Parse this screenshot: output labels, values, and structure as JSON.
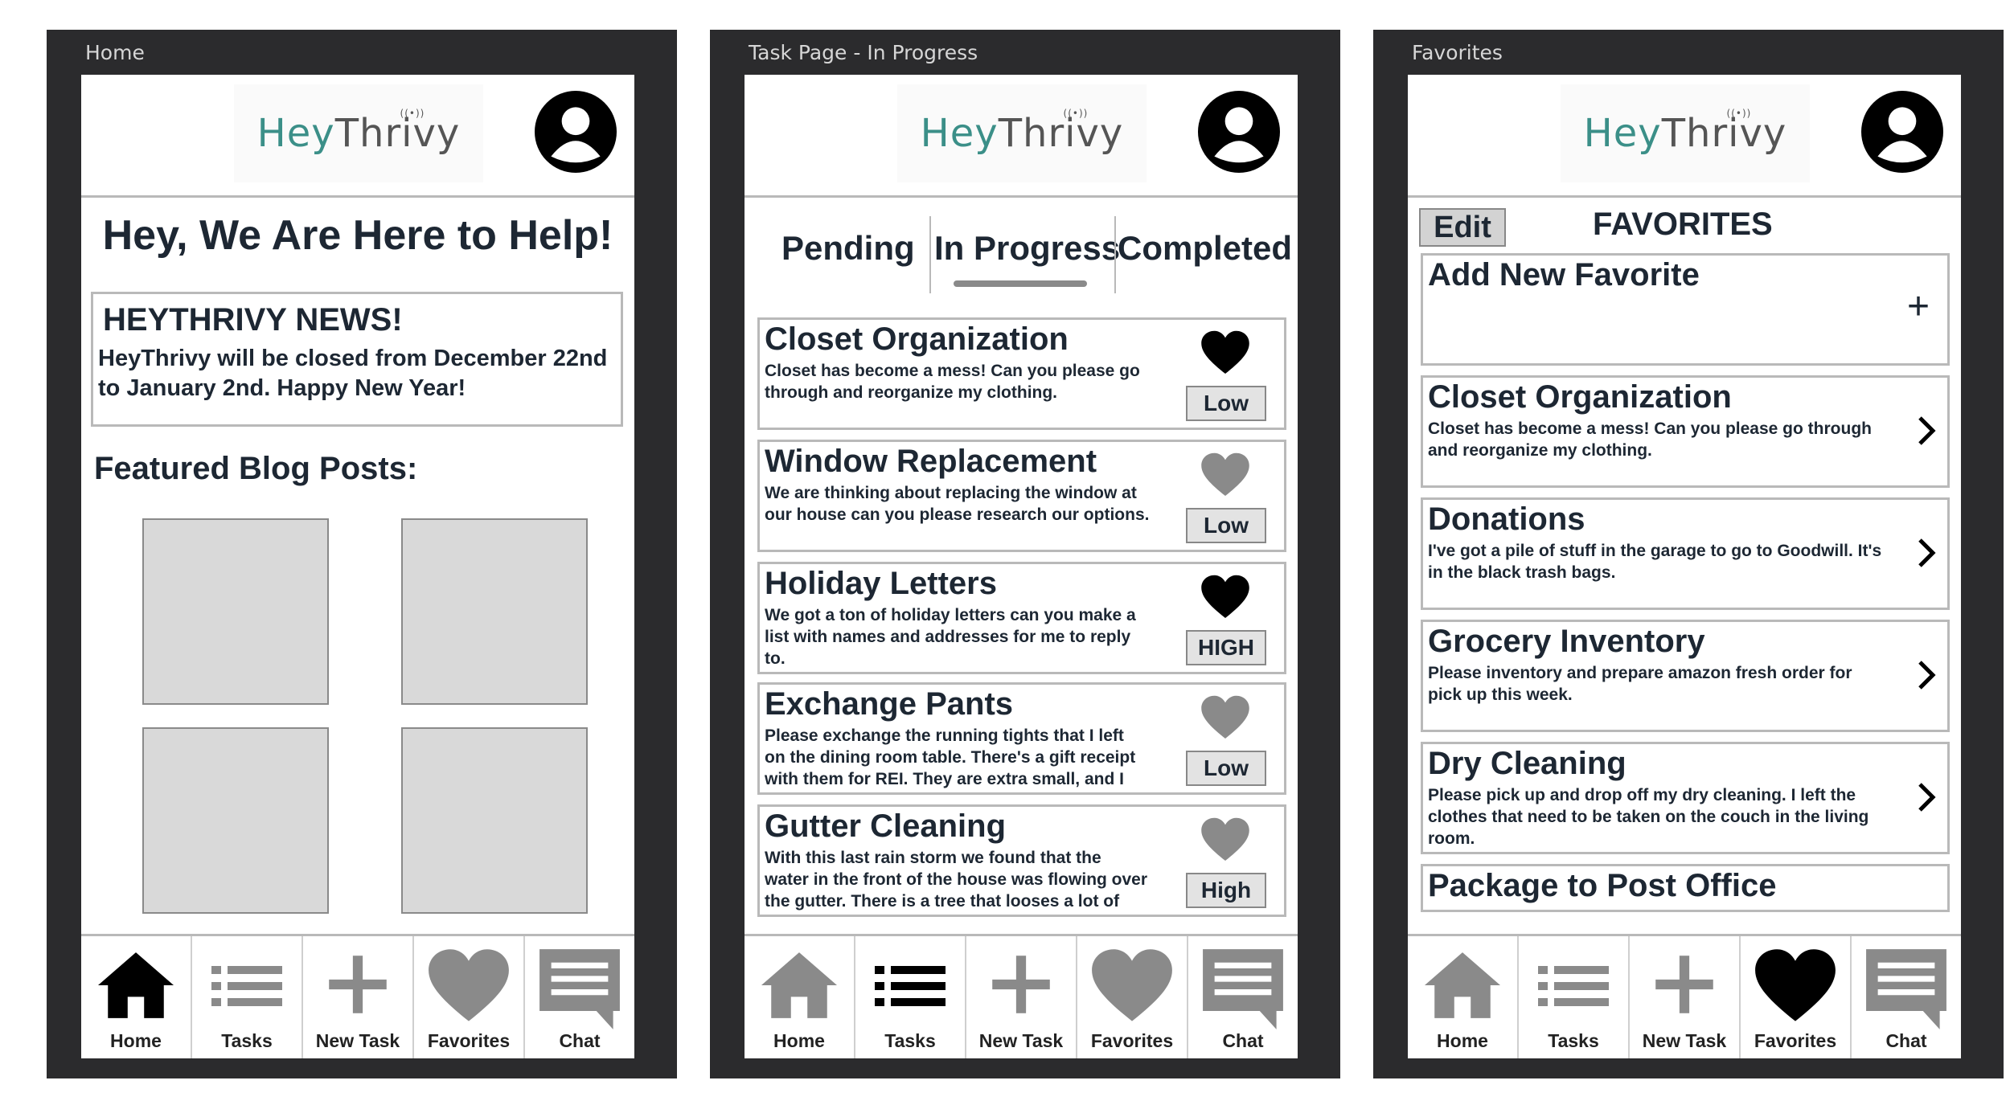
{
  "screens": {
    "home": {
      "frame_label": "Home",
      "logo_hey": "Hey",
      "logo_thrivy": "Thrivy",
      "heading": "Hey, We Are Here to Help!",
      "news_title": "HEYTHRIVY NEWS!",
      "news_body_line1": "HeyThrivy will be closed from December 22nd",
      "news_body_line2": "to January 2nd. Happy New Year!",
      "blog_heading": "Featured Blog Posts:"
    },
    "tasks": {
      "frame_label": "Task Page - In Progress",
      "logo_hey": "Hey",
      "logo_thrivy": "Thrivy",
      "tabs": [
        "Pending",
        "In Progress",
        "Completed"
      ],
      "active_tab": "In Progress",
      "items": [
        {
          "title": "Closet Organization",
          "line1": "Closet has become a mess! Can you please go",
          "line2": "through and reorganize my clothing.",
          "line3": "",
          "priority": "Low",
          "favorite": true
        },
        {
          "title": "Window Replacement",
          "line1": "We are thinking about replacing the window at",
          "line2": "our house can you please research our options.",
          "line3": "",
          "priority": "Low",
          "favorite": false
        },
        {
          "title": "Holiday Letters",
          "line1": "We got a ton of holiday letters can you make a",
          "line2": "list with names and addresses for me to reply",
          "line3": "to.",
          "priority": "HIGH",
          "favorite": true
        },
        {
          "title": "Exchange Pants",
          "line1": "Please exchange the running tights that I left",
          "line2": "on the dining room table. There's a gift receipt",
          "line3": "with them for REI. They are extra small, and I",
          "priority": "Low",
          "favorite": false
        },
        {
          "title": "Gutter Cleaning",
          "line1": "With this last rain storm we found that the",
          "line2": "water in the front of the house was flowing over",
          "line3": "the gutter. There is a tree that looses a lot of",
          "priority": "High",
          "favorite": false
        }
      ]
    },
    "favorites": {
      "frame_label": "Favorites",
      "logo_hey": "Hey",
      "logo_thrivy": "Thrivy",
      "edit_label": "Edit",
      "title": "FAVORITES",
      "add_new": "Add New Favorite",
      "add_icon": "+",
      "items": [
        {
          "title": "Closet Organization",
          "line1": "Closet has become a mess! Can you please go through",
          "line2": "and reorganize my clothing.",
          "line3": ""
        },
        {
          "title": "Donations",
          "line1": "I've got a pile of stuff in the garage to go to Goodwill. It's",
          "line2": "in the black trash bags.",
          "line3": ""
        },
        {
          "title": "Grocery Inventory",
          "line1": "Please inventory and prepare amazon fresh order for",
          "line2": "pick up this week.",
          "line3": ""
        },
        {
          "title": "Dry Cleaning",
          "line1": "Please pick up and drop off my dry cleaning. I left the",
          "line2": "clothes that need to be taken on the couch in the living",
          "line3": "room."
        },
        {
          "title": "Package to Post Office",
          "line1": "",
          "line2": "",
          "line3": ""
        }
      ]
    }
  },
  "nav": {
    "home": "Home",
    "tasks": "Tasks",
    "new_task": "New Task",
    "favorites": "Favorites",
    "chat": "Chat"
  },
  "colors": {
    "frame": "#2b2b2d",
    "brand_teal": "#3b8f88",
    "text_dark": "#1d2733",
    "active_icon": "#000000",
    "inactive_icon": "#8a8a8a",
    "placeholder": "#d9d9d9"
  }
}
